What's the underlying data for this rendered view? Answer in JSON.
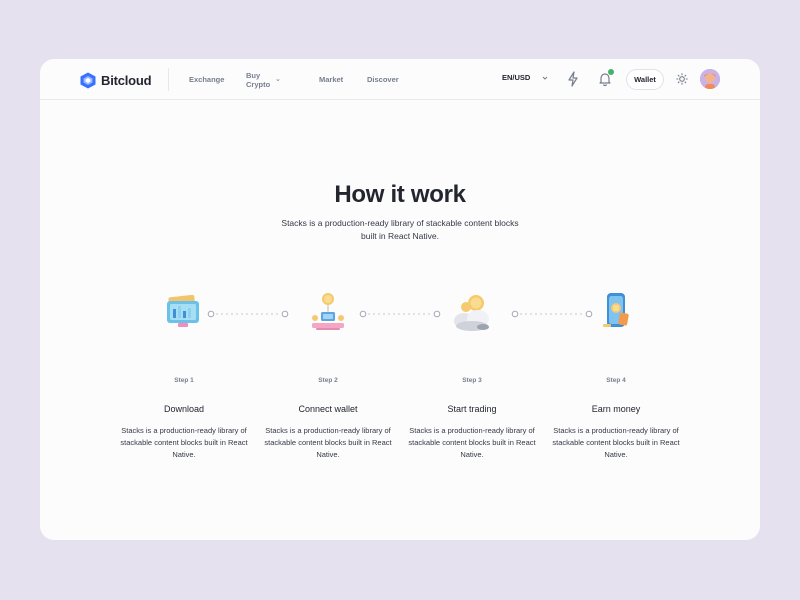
{
  "brand": {
    "name": "Bitcloud"
  },
  "nav": {
    "items": [
      {
        "label": "Exchange"
      },
      {
        "label": "Buy Crypto"
      },
      {
        "label": "Market"
      },
      {
        "label": "Discover"
      }
    ]
  },
  "header": {
    "language": "EN/USD",
    "wallet_label": "Wallet",
    "icons": [
      "lightning-icon",
      "bell-icon",
      "sun-icon"
    ],
    "notification_dot_color": "#45b26b"
  },
  "hero": {
    "title": "How it work",
    "subtitle": "Stacks is a production-ready library of stackable content blocks built in React Native."
  },
  "steps": [
    {
      "number": "Step 1",
      "title": "Download",
      "description": "Stacks is a production-ready library of stackable content blocks built in React Native."
    },
    {
      "number": "Step 2",
      "title": "Connect wallet",
      "description": "Stacks is a production-ready library of stackable content blocks built in React Native."
    },
    {
      "number": "Step 3",
      "title": "Start trading",
      "description": "Stacks is a production-ready library of stackable content blocks built in React Native."
    },
    {
      "number": "Step 4",
      "title": "Earn money",
      "description": "Stacks is a production-ready library of stackable content blocks built in React Native."
    }
  ],
  "colors": {
    "page_bg": "#e6e1ef",
    "card_bg": "#fcfcfd",
    "brand_blue": "#3772ff",
    "text_dark": "#23262f",
    "text_muted": "#777e90"
  }
}
